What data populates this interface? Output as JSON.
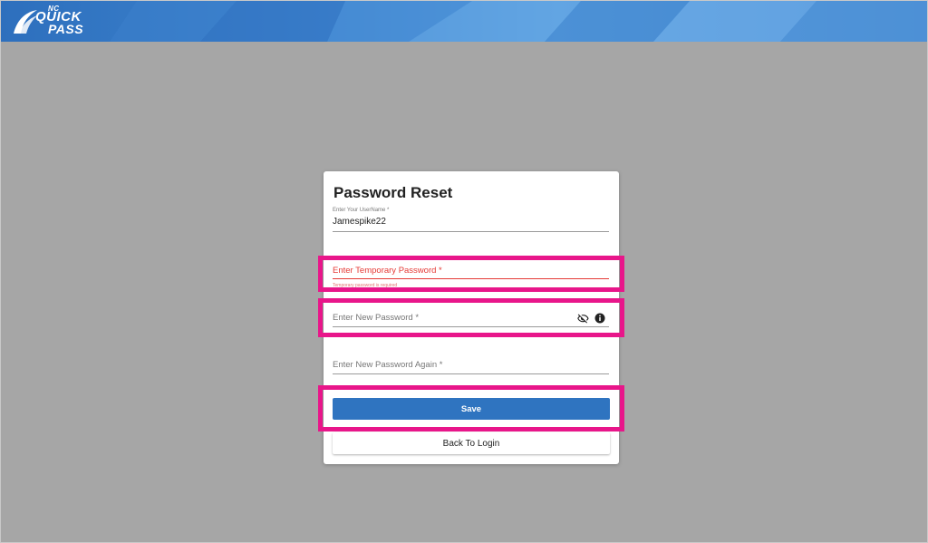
{
  "header": {
    "logo": {
      "top_text": "NC",
      "line1": "QUICK",
      "line2": "PASS"
    }
  },
  "card": {
    "title": "Password Reset",
    "username": {
      "label": "Enter Your UserName *",
      "value": "Jamespike22"
    },
    "temp_password": {
      "label": "Enter Temporary Password *",
      "helper": "Temporary password is required"
    },
    "new_password": {
      "label": "Enter New Password *",
      "eye_icon": "visibility-off-icon",
      "info_icon": "info-icon"
    },
    "new_password_again": {
      "label": "Enter New Password Again *"
    },
    "save_label": "Save",
    "back_label": "Back To Login"
  },
  "colors": {
    "header": "#3f86d0",
    "background": "#a6a6a6",
    "primary_button": "#2f74c0",
    "error": "#e53935",
    "highlight": "#e8168a"
  }
}
